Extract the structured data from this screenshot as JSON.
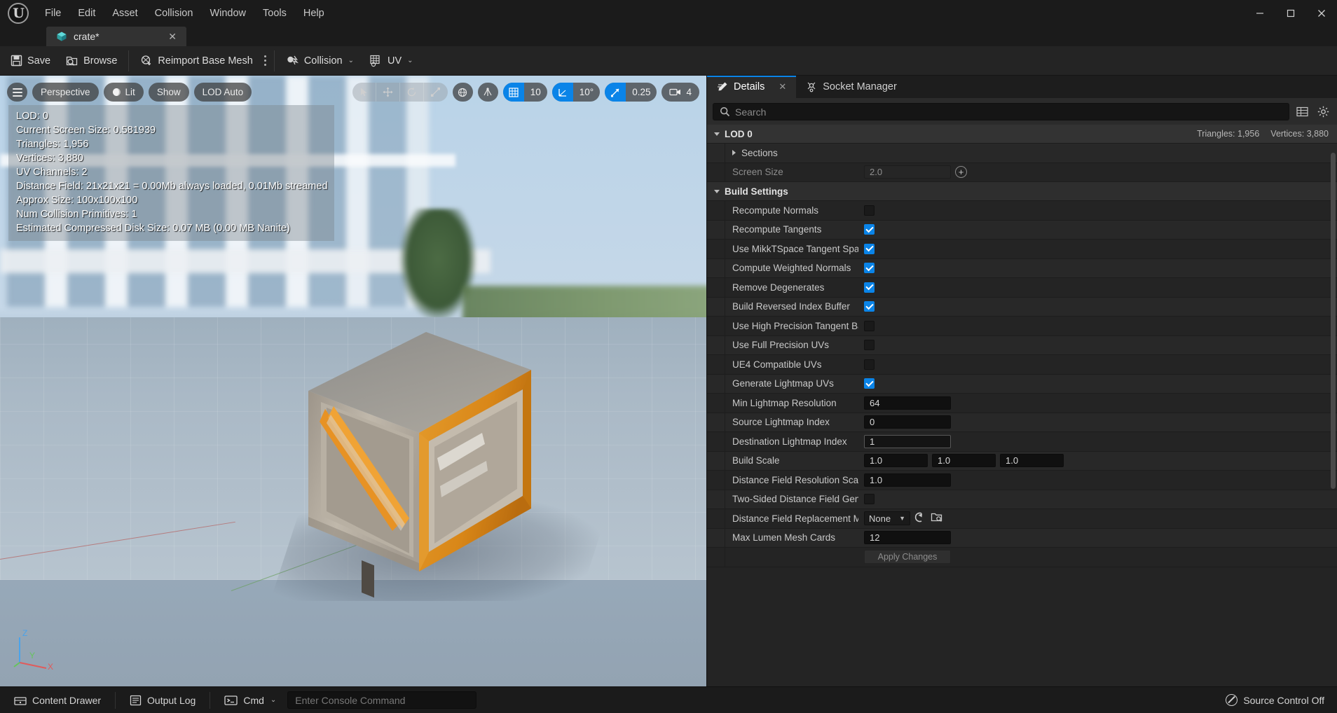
{
  "app": {
    "logo_text": "U",
    "menus": [
      "File",
      "Edit",
      "Asset",
      "Collision",
      "Window",
      "Tools",
      "Help"
    ],
    "window_controls": {
      "minimize": "─",
      "maximize": "☐",
      "close": "✕"
    }
  },
  "asset_tab": {
    "label": "crate*",
    "close": "✕",
    "icon": "mesh-cube-icon"
  },
  "toolbar": {
    "save": "Save",
    "browse": "Browse",
    "reimport": "Reimport Base Mesh",
    "collision": "Collision",
    "uv": "UV",
    "caret": "⌄"
  },
  "viewport": {
    "controls": {
      "view_mode": "Perspective",
      "lighting": "Lit",
      "show": "Show",
      "lod": "LOD Auto"
    },
    "snap": {
      "grid_icon": "grid-snap-icon",
      "grid_value": "10",
      "angle_icon": "angle-snap-icon",
      "angle_value": "10°",
      "scale_icon": "scale-snap-icon",
      "scale_value": "0.25",
      "camera_icon": "camera-speed-icon",
      "camera_value": "4"
    },
    "stats": [
      "LOD:  0",
      "Current Screen Size:  0.581939",
      "Triangles:  1,956",
      "Vertices:  3,880",
      "UV Channels:  2",
      "Distance Field:  21x21x21 = 0.00Mb always loaded, 0.01Mb streamed",
      "Approx Size: 100x100x100",
      "Num Collision Primitives:  1",
      "Estimated Compressed Disk Size: 0.07 MB (0.00 MB Nanite)"
    ],
    "axis": {
      "z": "Z",
      "y": "Y",
      "x": "X"
    }
  },
  "details": {
    "tabs": [
      {
        "label": "Details",
        "icon": "details-pencil-icon",
        "active": true,
        "close": "✕"
      },
      {
        "label": "Socket Manager",
        "icon": "socket-icon",
        "active": false
      }
    ],
    "search": {
      "placeholder": "Search",
      "value": "",
      "icon": "search-icon"
    },
    "header_buttons": [
      "grid-view-icon",
      "settings-gear-icon"
    ],
    "lod_section": {
      "title": "LOD 0",
      "triangles": "Triangles: 1,956",
      "vertices": "Vertices: 3,880"
    },
    "rows": [
      {
        "label": "Sections",
        "type": "expander",
        "expanded": false,
        "indent": 1
      },
      {
        "label": "Screen Size",
        "type": "number-plus",
        "value": "2.0",
        "disabled": true,
        "indent": 1
      },
      {
        "label": "Build Settings",
        "type": "category",
        "expanded": true,
        "indent": 0
      },
      {
        "label": "Recompute Normals",
        "type": "checkbox",
        "checked": false,
        "indent": 2
      },
      {
        "label": "Recompute Tangents",
        "type": "checkbox",
        "checked": true,
        "indent": 2
      },
      {
        "label": "Use MikkTSpace Tangent Space",
        "type": "checkbox",
        "checked": true,
        "indent": 2
      },
      {
        "label": "Compute Weighted Normals",
        "type": "checkbox",
        "checked": true,
        "indent": 2
      },
      {
        "label": "Remove Degenerates",
        "type": "checkbox",
        "checked": true,
        "indent": 2
      },
      {
        "label": "Build Reversed Index Buffer",
        "type": "checkbox",
        "checked": true,
        "indent": 2
      },
      {
        "label": "Use High Precision Tangent Basis",
        "type": "checkbox",
        "checked": false,
        "indent": 2
      },
      {
        "label": "Use Full Precision UVs",
        "type": "checkbox",
        "checked": false,
        "indent": 2
      },
      {
        "label": "UE4 Compatible UVs",
        "type": "checkbox",
        "checked": false,
        "indent": 2
      },
      {
        "label": "Generate Lightmap UVs",
        "type": "checkbox",
        "checked": true,
        "indent": 2
      },
      {
        "label": "Min Lightmap Resolution",
        "type": "number",
        "value": "64",
        "indent": 2
      },
      {
        "label": "Source Lightmap Index",
        "type": "number",
        "value": "0",
        "indent": 2
      },
      {
        "label": "Destination Lightmap Index",
        "type": "number",
        "value": "1",
        "focused": true,
        "indent": 2
      },
      {
        "label": "Build Scale",
        "type": "vector3",
        "values": [
          "1.0",
          "1.0",
          "1.0"
        ],
        "indent": 2
      },
      {
        "label": "Distance Field Resolution Scale",
        "type": "number",
        "value": "1.0",
        "indent": 2
      },
      {
        "label": "Two-Sided Distance Field Generation",
        "type": "checkbox",
        "checked": false,
        "indent": 2
      },
      {
        "label": "Distance Field Replacement Mesh",
        "type": "asset-picker",
        "value": "None",
        "indent": 2
      },
      {
        "label": "Max Lumen Mesh Cards",
        "type": "number",
        "value": "12",
        "indent": 2
      },
      {
        "label": "",
        "type": "apply",
        "value": "Apply Changes",
        "indent": 2
      }
    ]
  },
  "statusbar": {
    "content_drawer": "Content Drawer",
    "output_log": "Output Log",
    "cmd": "Cmd",
    "cmd_caret": "⌄",
    "console_placeholder": "Enter Console Command",
    "console_value": "",
    "source_control": "Source Control Off"
  },
  "colors": {
    "accent": "#0a84e8",
    "panel_bg": "#242424",
    "toolbar_bg": "#242424",
    "titlebar_bg": "#1b1b1b",
    "row_alt": "#282828",
    "crate_orange": "#e08a21",
    "crate_gray": "#b3ab9e"
  }
}
